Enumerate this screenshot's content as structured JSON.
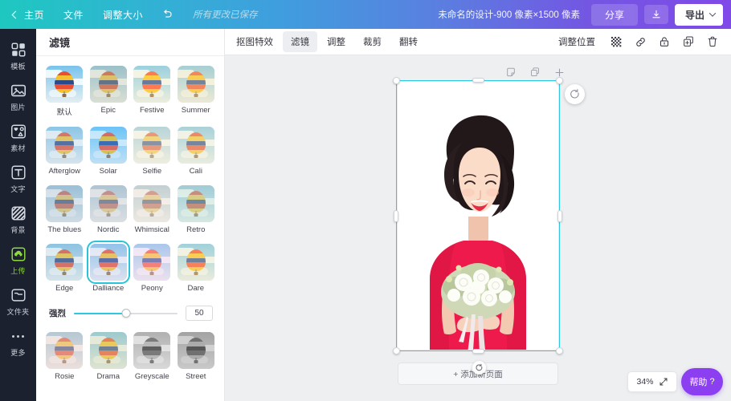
{
  "topbar": {
    "home_label": "主页",
    "file_label": "文件",
    "resize_label": "调整大小",
    "undo_icon": "undo-arrow-icon",
    "saved_status": "所有更改已保存",
    "doc_title": "未命名的设计-900 像素×1500 像素",
    "share_label": "分享",
    "download_icon": "download-icon",
    "export_label": "导出",
    "export_caret_icon": "chevron-down-icon"
  },
  "rail": {
    "items": [
      {
        "label": "模板",
        "icon": "templates-icon",
        "active": false
      },
      {
        "label": "图片",
        "icon": "photo-icon",
        "active": false
      },
      {
        "label": "素材",
        "icon": "elements-icon",
        "active": false
      },
      {
        "label": "文字",
        "icon": "text-icon",
        "active": false
      },
      {
        "label": "背景",
        "icon": "background-icon",
        "active": false
      },
      {
        "label": "上传",
        "icon": "upload-cloud-icon",
        "active": true
      },
      {
        "label": "文件夹",
        "icon": "folder-icon",
        "active": false
      },
      {
        "label": "更多",
        "icon": "more-dots-icon",
        "active": false
      }
    ]
  },
  "panel": {
    "title": "滤镜",
    "filters": [
      {
        "name": "默认",
        "tint": "rgba(255,255,255,0)",
        "sat": 1.0,
        "selected": false
      },
      {
        "name": "Epic",
        "tint": "rgba(198,196,150,0.35)",
        "sat": 0.8,
        "selected": false
      },
      {
        "name": "Festive",
        "tint": "rgba(255,236,180,0.30)",
        "sat": 1.15,
        "selected": false
      },
      {
        "name": "Summer",
        "tint": "rgba(247,226,168,0.38)",
        "sat": 1.05,
        "selected": false
      },
      {
        "name": "Afterglow",
        "tint": "rgba(180,205,225,0.30)",
        "sat": 0.95,
        "selected": false
      },
      {
        "name": "Solar",
        "tint": "rgba(120,190,235,0.30)",
        "sat": 1.2,
        "selected": false
      },
      {
        "name": "Selfie",
        "tint": "rgba(253,238,196,0.45)",
        "sat": 0.85,
        "selected": false
      },
      {
        "name": "Cali",
        "tint": "rgba(245,233,190,0.38)",
        "sat": 0.95,
        "selected": false
      },
      {
        "name": "The blues",
        "tint": "rgba(170,196,216,0.42)",
        "sat": 0.7,
        "selected": false
      },
      {
        "name": "Nordic",
        "tint": "rgba(205,205,212,0.48)",
        "sat": 0.6,
        "selected": false
      },
      {
        "name": "Whimsical",
        "tint": "rgba(250,226,196,0.50)",
        "sat": 0.55,
        "selected": false
      },
      {
        "name": "Retro",
        "tint": "rgba(186,225,200,0.42)",
        "sat": 0.75,
        "selected": false
      },
      {
        "name": "Edge",
        "tint": "rgba(176,200,216,0.28)",
        "sat": 0.9,
        "selected": false
      },
      {
        "name": "Dalliance",
        "tint": "rgba(205,195,228,0.30)",
        "sat": 1.0,
        "selected": true
      },
      {
        "name": "Peony",
        "tint": "rgba(248,205,230,0.40)",
        "sat": 1.05,
        "selected": false
      },
      {
        "name": "Dare",
        "tint": "rgba(246,232,180,0.35)",
        "sat": 1.1,
        "selected": false
      },
      {
        "name": "Rosie",
        "tint": "rgba(248,206,190,0.45)",
        "sat": 0.85,
        "selected": false
      },
      {
        "name": "Drama",
        "tint": "rgba(215,212,160,0.40)",
        "sat": 1.0,
        "selected": false
      },
      {
        "name": "Greyscale",
        "tint": "rgba(160,160,160,0.25)",
        "sat": 0.0,
        "selected": false
      },
      {
        "name": "Street",
        "tint": "rgba(120,120,120,0.30)",
        "sat": 0.0,
        "selected": false
      }
    ],
    "slider": {
      "label": "强烈",
      "value": "50",
      "percent": 50
    }
  },
  "editor_toolbar": {
    "tabs": [
      {
        "label": "抠图特效",
        "active": false
      },
      {
        "label": "滤镜",
        "active": true
      },
      {
        "label": "调整",
        "active": false
      },
      {
        "label": "裁剪",
        "active": false
      },
      {
        "label": "翻转",
        "active": false
      }
    ],
    "position_label": "调整位置",
    "icons": [
      {
        "name": "transparency-icon"
      },
      {
        "name": "link-icon"
      },
      {
        "name": "lock-icon"
      },
      {
        "name": "duplicate-icon"
      },
      {
        "name": "trash-icon"
      }
    ]
  },
  "canvas": {
    "page_tools": [
      {
        "name": "notes-icon"
      },
      {
        "name": "copy-page-icon"
      },
      {
        "name": "add-page-plus-icon"
      }
    ],
    "rotate_handle_icon": "rotate-icon",
    "add_page_label": "+ 添加新页面",
    "rotate_cursor_icon": "rotate-cursor-icon"
  },
  "footer": {
    "zoom_level": "34%",
    "fullscreen_icon": "expand-arrows-icon",
    "help_label": "帮助",
    "help_mark": "?"
  },
  "colors": {
    "accent_cyan": "#2ec9e0",
    "rail_bg": "#1c2130",
    "upload_green": "#8fd93f",
    "purple": "#8b3ff0",
    "stage_bg": "#eeeff1"
  }
}
